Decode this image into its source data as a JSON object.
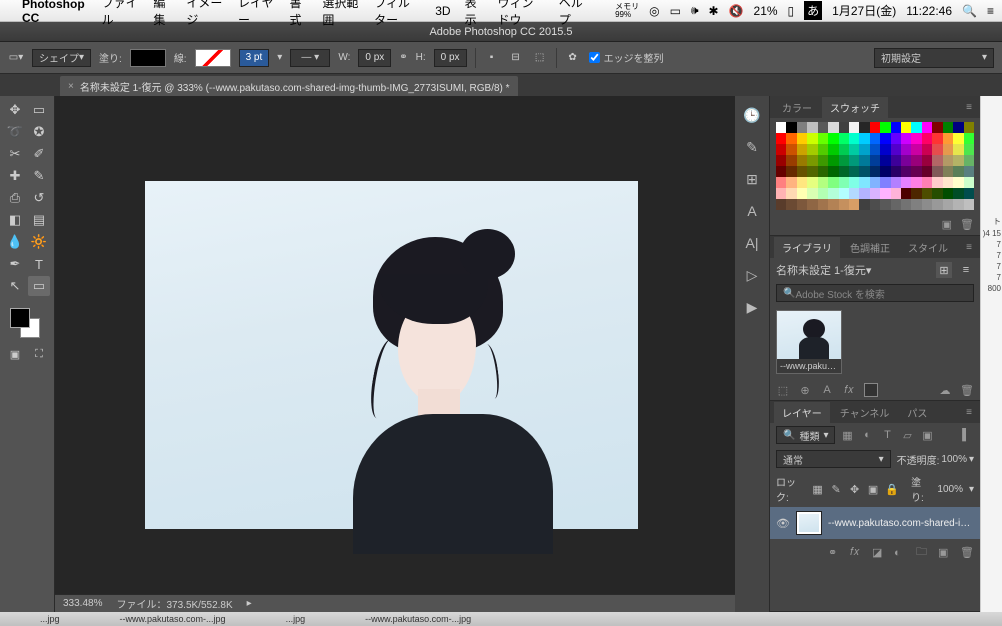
{
  "mac_menu": {
    "app": "Photoshop CC",
    "items": [
      "ファイル",
      "編集",
      "イメージ",
      "レイヤー",
      "書式",
      "選択範囲",
      "フィルター",
      "3D",
      "表示",
      "ウィンドウ",
      "ヘルプ"
    ],
    "mem_label": "メモリ",
    "mem_val": "99%",
    "battery": "21%",
    "ime": "あ",
    "date": "1月27日(金)",
    "time": "11:22:46"
  },
  "window_title": "Adobe Photoshop CC 2015.5",
  "options": {
    "shape_label": "シェイプ",
    "fill_label": "塗り:",
    "stroke_label": "線:",
    "stroke_val": "3 pt",
    "w_label": "W:",
    "w_val": "0 px",
    "h_label": "H:",
    "h_val": "0 px",
    "align_edges": "エッジを整列",
    "preset": "初期設定"
  },
  "doc_tab": "名称未設定 1-復元 @ 333% (--www.pakutaso.com-shared-img-thumb-IMG_2773ISUMI, RGB/8) *",
  "status": {
    "zoom": "333.48%",
    "file": "ファイル：373.5K/552.8K"
  },
  "panels": {
    "color_tab": "カラー",
    "swatch_tab": "スウォッチ",
    "library_tab": "ライブラリ",
    "cc_tab": "色調補正",
    "style_tab": "スタイル",
    "doc_select": "名称未設定 1-復元",
    "search_placeholder": "Adobe Stock を検索",
    "thumb_label": "--www.pakutaso...",
    "layers_tab": "レイヤー",
    "channels_tab": "チャンネル",
    "paths_tab": "パス",
    "kind_label": "種類",
    "blend_mode": "通常",
    "opacity_label": "不透明度:",
    "opacity_val": "100%",
    "lock_label": "ロック:",
    "fill_label": "塗り:",
    "fill_val": "100%",
    "layer_name": "--www.pakutaso.com-shared-img-th..."
  },
  "swatch_colors": [
    [
      "#ffffff",
      "#000000",
      "#7f7f7f",
      "#bfbfbf",
      "#595959",
      "#d9d9d9",
      "#404040",
      "#f2f2f2",
      "#262626",
      "#ff0000",
      "#00ff00",
      "#0000ff",
      "#ffff00",
      "#00ffff",
      "#ff00ff",
      "#800000",
      "#008000",
      "#000080",
      "#808000"
    ],
    [
      "#ff0000",
      "#ff6600",
      "#ffcc00",
      "#ccff00",
      "#66ff00",
      "#00ff00",
      "#00ff66",
      "#00ffcc",
      "#00ccff",
      "#0066ff",
      "#0000ff",
      "#6600ff",
      "#cc00ff",
      "#ff00cc",
      "#ff0066",
      "#ff3333",
      "#ff9933",
      "#ffff33",
      "#33ff33"
    ],
    [
      "#cc0000",
      "#cc5200",
      "#cca300",
      "#a3cc00",
      "#52cc00",
      "#00cc00",
      "#00cc52",
      "#00cca3",
      "#00a3cc",
      "#0052cc",
      "#0000cc",
      "#5200cc",
      "#a300cc",
      "#cc00a3",
      "#cc0052",
      "#e64d4d",
      "#e6994d",
      "#e6e64d",
      "#4de64d"
    ],
    [
      "#990000",
      "#993d00",
      "#997a00",
      "#7a9900",
      "#3d9900",
      "#009900",
      "#00993d",
      "#00997a",
      "#007a99",
      "#003d99",
      "#000099",
      "#3d0099",
      "#7a0099",
      "#99007a",
      "#99003d",
      "#b36666",
      "#b39966",
      "#b3b366",
      "#66b366"
    ],
    [
      "#660000",
      "#662900",
      "#665200",
      "#526600",
      "#296600",
      "#006600",
      "#006629",
      "#006652",
      "#005266",
      "#002966",
      "#000066",
      "#290066",
      "#520066",
      "#660052",
      "#660029",
      "#805959",
      "#808059",
      "#598059",
      "#598080"
    ],
    [
      "#ff8080",
      "#ffb380",
      "#ffe680",
      "#e6ff80",
      "#b3ff80",
      "#80ff80",
      "#80ffb3",
      "#80ffe6",
      "#80e6ff",
      "#80b3ff",
      "#8080ff",
      "#b380ff",
      "#e680ff",
      "#ff80e6",
      "#ff80b3",
      "#ffcccc",
      "#ffe6cc",
      "#ffffcc",
      "#ccffcc"
    ],
    [
      "#ffb3b3",
      "#ffd9b3",
      "#ffffb3",
      "#d9ffb3",
      "#b3ffb3",
      "#b3ffd9",
      "#b3ffff",
      "#b3d9ff",
      "#b3b3ff",
      "#d9b3ff",
      "#ffb3ff",
      "#ffb3d9",
      "#4d0000",
      "#4d2600",
      "#4d4d00",
      "#264d00",
      "#004d00",
      "#004d26",
      "#004d4d"
    ],
    [
      "#593c2b",
      "#6b4a33",
      "#7d583c",
      "#8f6644",
      "#a1744d",
      "#b38255",
      "#c5905e",
      "#d79e66",
      "#404040",
      "#4d4d4d",
      "#595959",
      "#666666",
      "#737373",
      "#808080",
      "#8c8c8c",
      "#999999",
      "#a6a6a6",
      "#b3b3b3",
      "#bfbfbf"
    ]
  ],
  "dock_files": [
    "...jpg",
    "--www.pakutaso.com-...jpg",
    "...jpg",
    "--www.pakutaso.com-...jpg"
  ]
}
